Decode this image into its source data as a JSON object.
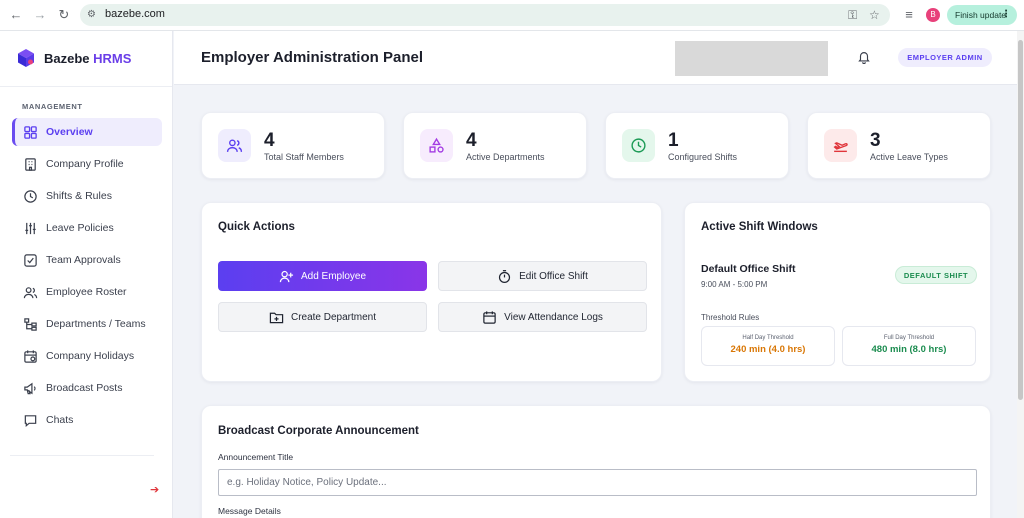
{
  "browser": {
    "url": "bazebe.com",
    "profile_initial": "B",
    "update_button": "Finish update",
    "back_icon": "arrow-left-icon",
    "forward_icon": "arrow-right-icon",
    "reload_icon": "reload-icon"
  },
  "sidebar": {
    "brand_main": "Bazebe",
    "brand_accent": "HRMS",
    "section_label": "MANAGEMENT",
    "items": [
      {
        "label": "Overview",
        "icon": "grid-icon",
        "active": true
      },
      {
        "label": "Company Profile",
        "icon": "building-icon"
      },
      {
        "label": "Shifts & Rules",
        "icon": "clock-icon"
      },
      {
        "label": "Leave Policies",
        "icon": "sliders-icon"
      },
      {
        "label": "Team Approvals",
        "icon": "check-square-icon"
      },
      {
        "label": "Employee Roster",
        "icon": "users-icon"
      },
      {
        "label": "Departments / Teams",
        "icon": "hierarchy-icon"
      },
      {
        "label": "Company Holidays",
        "icon": "calendar-icon"
      },
      {
        "label": "Broadcast Posts",
        "icon": "megaphone-icon"
      },
      {
        "label": "Chats",
        "icon": "chat-icon"
      }
    ]
  },
  "header": {
    "title": "Employer Administration Panel",
    "role_badge": "EMPLOYER ADMIN"
  },
  "stats": [
    {
      "value": "4",
      "label": "Total Staff Members",
      "icon": "users-icon",
      "color": "#5b3ff0",
      "bg": "#efedfd"
    },
    {
      "value": "4",
      "label": "Active Departments",
      "icon": "shapes-icon",
      "color": "#a33be3",
      "bg": "#f7ecfd"
    },
    {
      "value": "1",
      "label": "Configured Shifts",
      "icon": "clock-icon",
      "color": "#1b9a55",
      "bg": "#e4f7ec"
    },
    {
      "value": "3",
      "label": "Active Leave Types",
      "icon": "plane-icon",
      "color": "#e0353b",
      "bg": "#fdeaea"
    }
  ],
  "quick_actions": {
    "title": "Quick Actions",
    "buttons": {
      "add_employee": "Add Employee",
      "edit_shift": "Edit Office Shift",
      "create_department": "Create Department",
      "view_logs": "View Attendance Logs"
    }
  },
  "shift_windows": {
    "title": "Active Shift Windows",
    "shift_name": "Default Office Shift",
    "shift_time": "9:00 AM - 5:00 PM",
    "badge": "DEFAULT SHIFT",
    "threshold_title": "Threshold Rules",
    "half_day_label": "Half Day Threshold",
    "half_day_value": "240 min (4.0 hrs)",
    "full_day_label": "Full Day Threshold",
    "full_day_value": "480 min (8.0 hrs)",
    "half_color": "#d97706",
    "full_color": "#1b8c4f"
  },
  "announcement": {
    "title": "Broadcast Corporate Announcement",
    "title_field_label": "Announcement Title",
    "title_placeholder": "e.g. Holiday Notice, Policy Update...",
    "message_label": "Message Details"
  }
}
